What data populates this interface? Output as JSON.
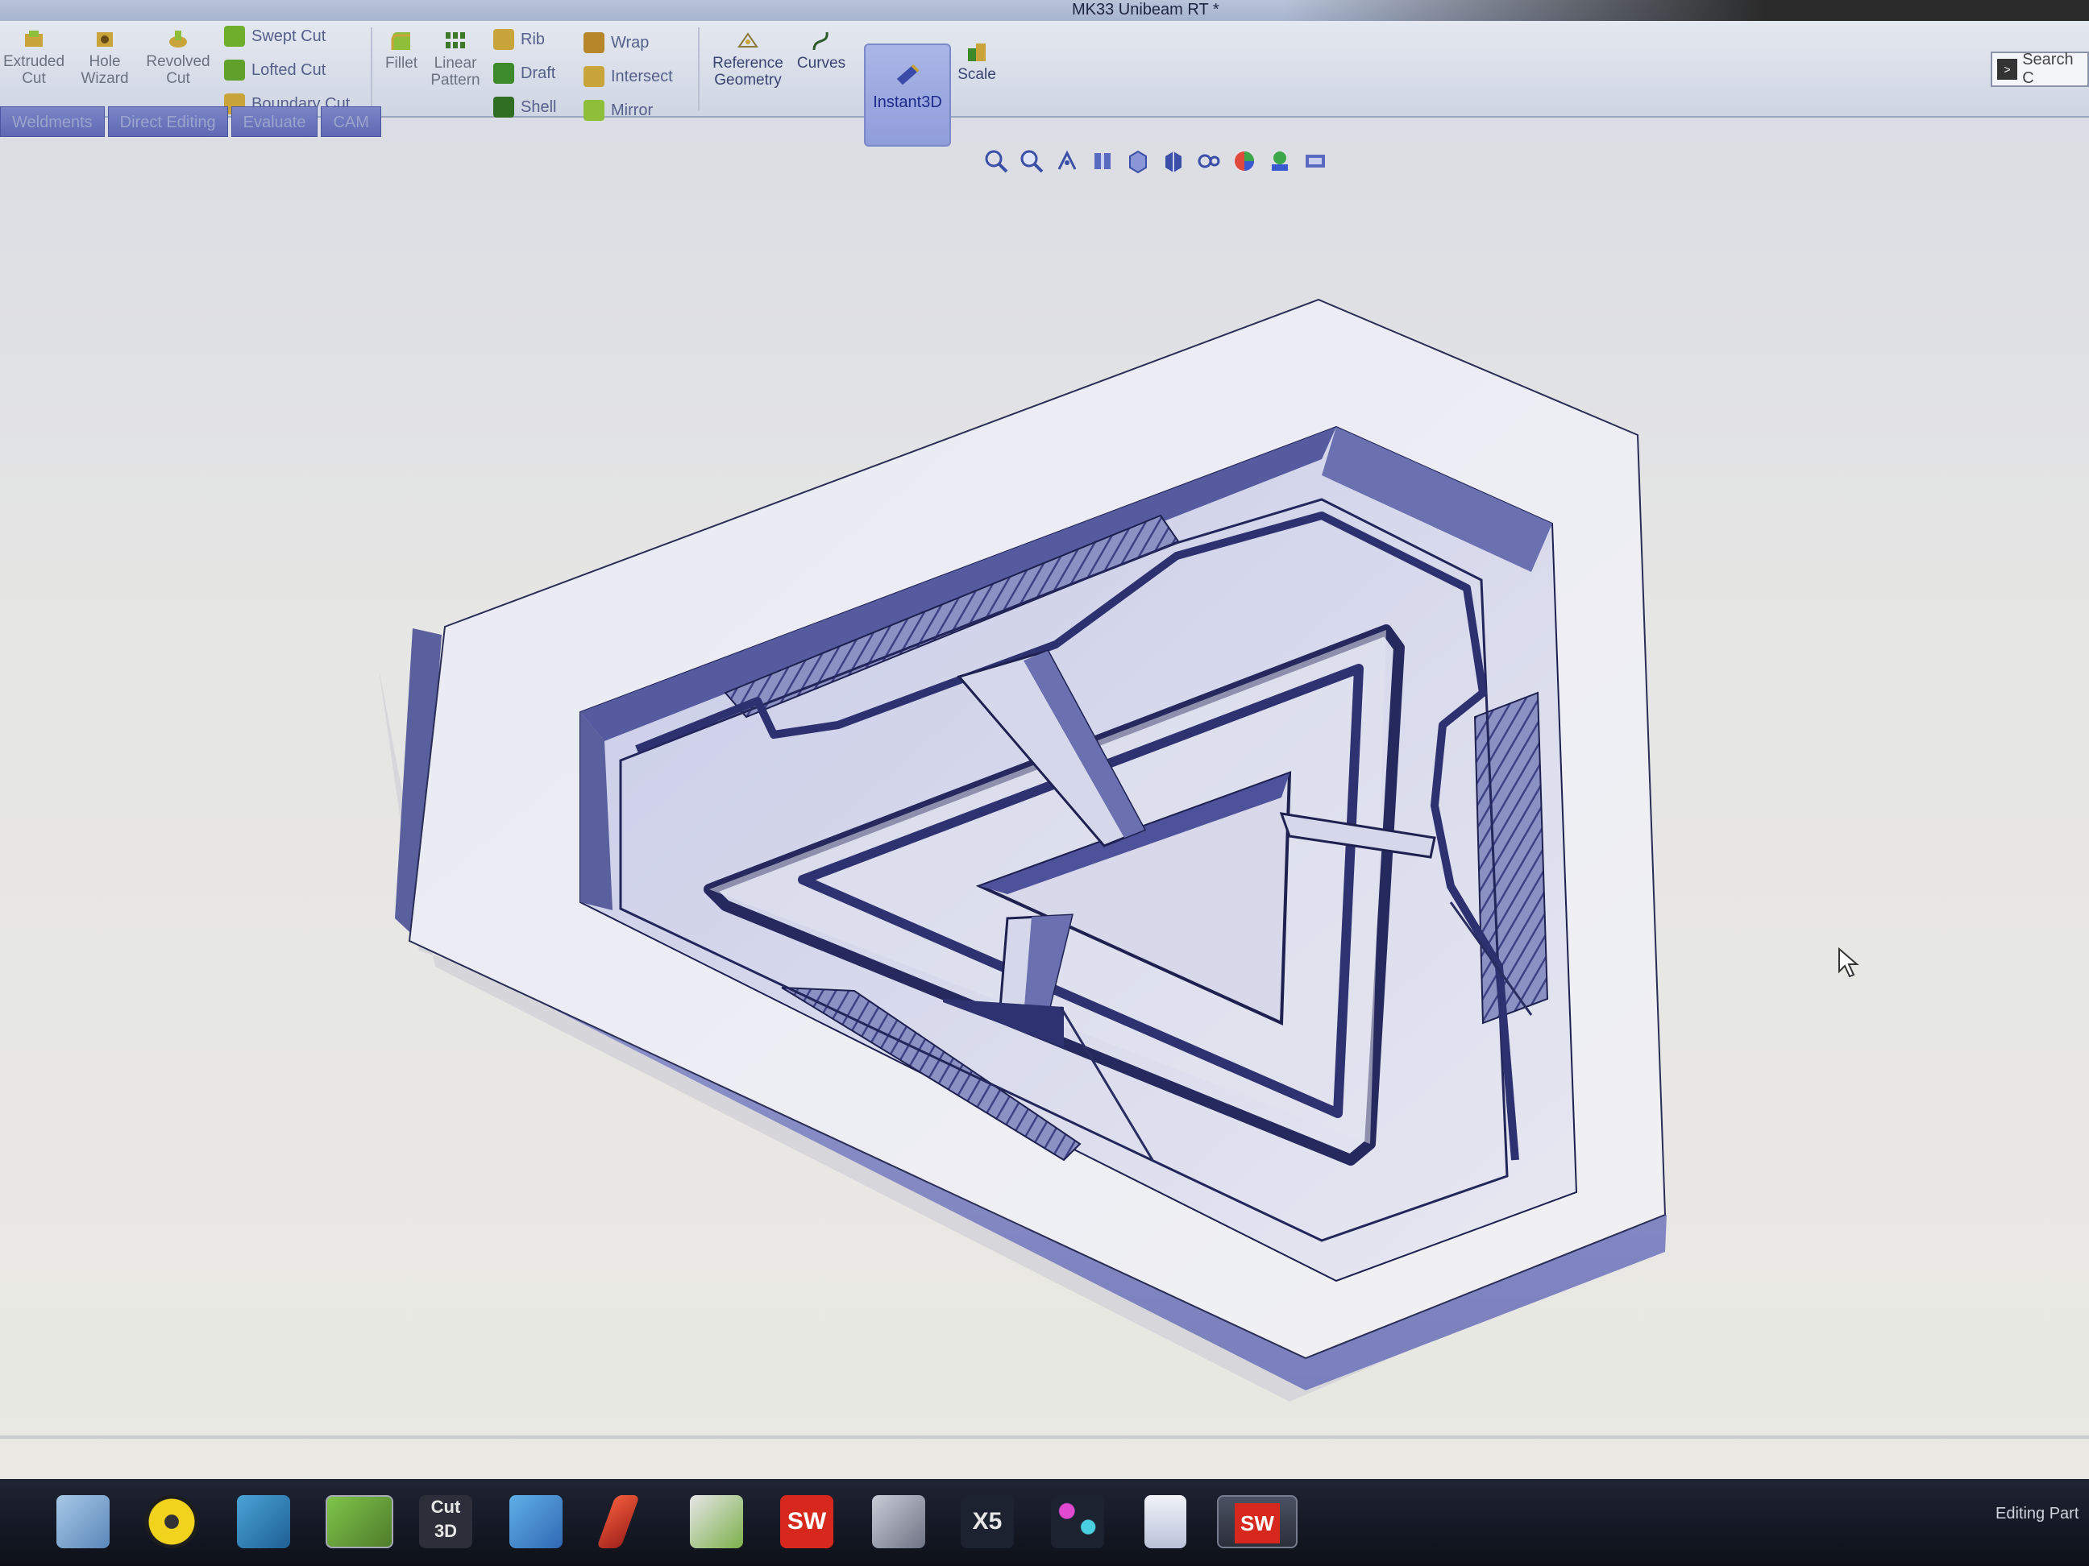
{
  "window": {
    "title": "MK33 Unibeam RT *"
  },
  "ribbon": {
    "extruded_cut": "Extruded Cut",
    "hole_wizard": "Hole Wizard",
    "revolved_cut": "Revolved Cut",
    "swept_cut": "Swept Cut",
    "lofted_cut": "Lofted Cut",
    "boundary_cut": "Boundary Cut",
    "fillet": "Fillet",
    "linear_pattern": "Linear Pattern",
    "rib": "Rib",
    "draft": "Draft",
    "shell": "Shell",
    "wrap": "Wrap",
    "intersect": "Intersect",
    "mirror": "Mirror",
    "reference_geometry": "Reference Geometry",
    "curves": "Curves",
    "instant3d": "Instant3D",
    "scale": "Scale",
    "search": "Search C"
  },
  "tabs": [
    {
      "label": "Weldments"
    },
    {
      "label": "Direct Editing"
    },
    {
      "label": "Evaluate"
    },
    {
      "label": "CAM"
    }
  ],
  "viewbar_icons": [
    "zoom-to-fit-icon",
    "zoom-area-icon",
    "previous-view-icon",
    "section-view-icon",
    "view-orientation-icon",
    "display-style-icon",
    "hide-show-icon",
    "edit-appearance-icon",
    "apply-scene-icon",
    "view-settings-icon"
  ],
  "taskbar_icons": [
    "file-explorer-icon",
    "media-disc-icon",
    "app-icon",
    "sketch-app-icon",
    "cut3d-icon",
    "browser-icon",
    "pen-tool-icon",
    "ds-app-icon",
    "solidworks-icon",
    "scanner-icon",
    "x5-app-icon",
    "molecule-app-icon",
    "document-icon",
    "solidworks-active-icon"
  ],
  "taskbar_labels": {
    "cut3d": "Cut 3D",
    "solidworks": "SW",
    "x5": "X5"
  },
  "status": {
    "text": "Editing Part"
  },
  "colors": {
    "model_face": "#eceef4",
    "model_side": "#8f94c7",
    "model_dark": "#5a5f9e",
    "ribbon_accent": "#8f9ddb"
  }
}
